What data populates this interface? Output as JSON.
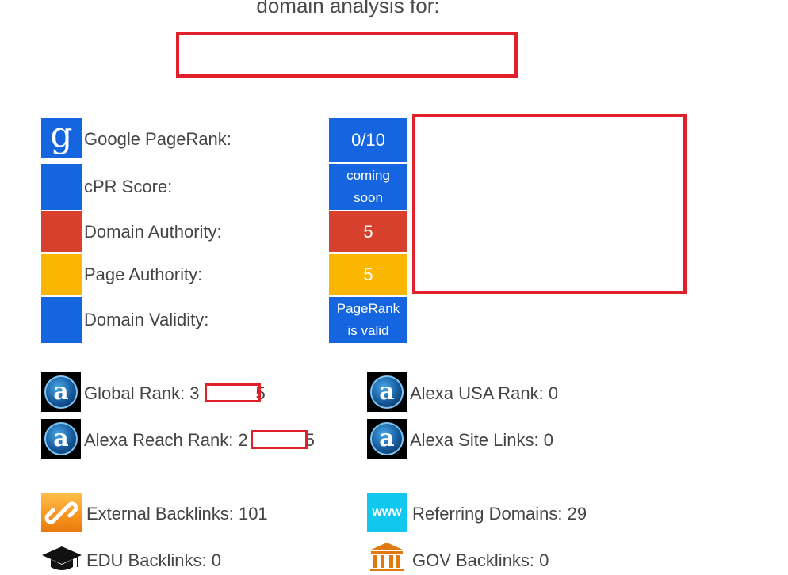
{
  "header": {
    "title": "domain analysis for:"
  },
  "metrics": [
    {
      "label": "Google PageRank:",
      "value": "0/10",
      "color": "#1565e0",
      "icon": "google-icon"
    },
    {
      "label": "cPR Score:",
      "value": "coming soon",
      "color": "#1565e0",
      "icon": "blue-square"
    },
    {
      "label": "Domain Authority:",
      "value": "5",
      "color": "#d6402c",
      "icon": "red-square"
    },
    {
      "label": "Page Authority:",
      "value": "5",
      "color": "#fbb700",
      "icon": "yellow-square"
    },
    {
      "label": "Domain Validity:",
      "value": "PageRank is valid",
      "color": "#1565e0",
      "icon": "blue-square"
    }
  ],
  "value_lines": {
    "cpr": [
      "coming",
      "soon"
    ],
    "validity": [
      "PageRank",
      "is valid"
    ]
  },
  "alexa": {
    "global_rank_prefix": "Global Rank: 3",
    "global_rank_suffix": "5",
    "reach_rank_prefix": "Alexa Reach Rank: 2",
    "reach_rank_suffix": "5",
    "usa_rank": "Alexa USA Rank: 0",
    "site_links": "Alexa Site Links: 0"
  },
  "backlinks": {
    "external": "External Backlinks: 101",
    "referring": "Referring Domains: 29",
    "edu": "EDU Backlinks: 0",
    "gov": "GOV Backlinks: 0"
  },
  "icons": {
    "google_letter": "g",
    "alexa_letter": "a",
    "www": "www"
  },
  "colors": {
    "blue": "#1565e0",
    "red": "#d6402c",
    "yellow": "#fbb700",
    "redaction": "#e0202a",
    "cyan": "#12c7ee",
    "orange": "#f7931e"
  }
}
